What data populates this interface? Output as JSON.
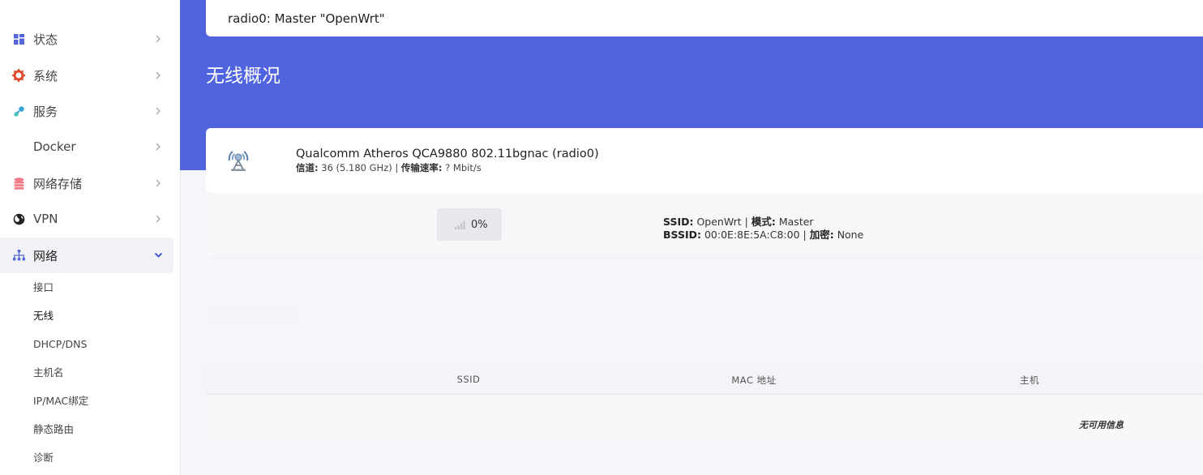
{
  "topbar": {
    "text": "radio0: Master \"OpenWrt\""
  },
  "page": {
    "title": "无线概况"
  },
  "sidebar": {
    "items": [
      {
        "label": "状态",
        "icon": "dashboard-icon"
      },
      {
        "label": "系统",
        "icon": "gear-icon"
      },
      {
        "label": "服务",
        "icon": "services-icon"
      },
      {
        "label": "Docker",
        "icon": ""
      },
      {
        "label": "网络存储",
        "icon": "database-icon"
      },
      {
        "label": "VPN",
        "icon": "globe-icon"
      },
      {
        "label": "网络",
        "icon": "network-tree-icon"
      }
    ],
    "subitems": [
      {
        "label": "接口"
      },
      {
        "label": "无线"
      },
      {
        "label": "DHCP/DNS"
      },
      {
        "label": "主机名"
      },
      {
        "label": "IP/MAC绑定"
      },
      {
        "label": "静态路由"
      },
      {
        "label": "诊断"
      }
    ]
  },
  "radio": {
    "name": "Qualcomm Atheros QCA9880 802.11bgnac (radio0)",
    "channel_label": "信道:",
    "channel_value": "36 (5.180 GHz)",
    "rate_label": "传输速率:",
    "rate_value": "? Mbit/s"
  },
  "network": {
    "signal": "0%",
    "ssid_label": "SSID:",
    "ssid_value": "OpenWrt",
    "mode_label": "模式:",
    "mode_value": "Master",
    "bssid_label": "BSSID:",
    "bssid_value": "00:0E:8E:5A:C8:00",
    "enc_label": "加密:",
    "enc_value": "None"
  },
  "stations": {
    "title": "已连接站点",
    "columns": [
      "SSID",
      "MAC 地址",
      "主机"
    ],
    "empty": "无可用信息"
  },
  "colors": {
    "accent": "#5064e0"
  }
}
